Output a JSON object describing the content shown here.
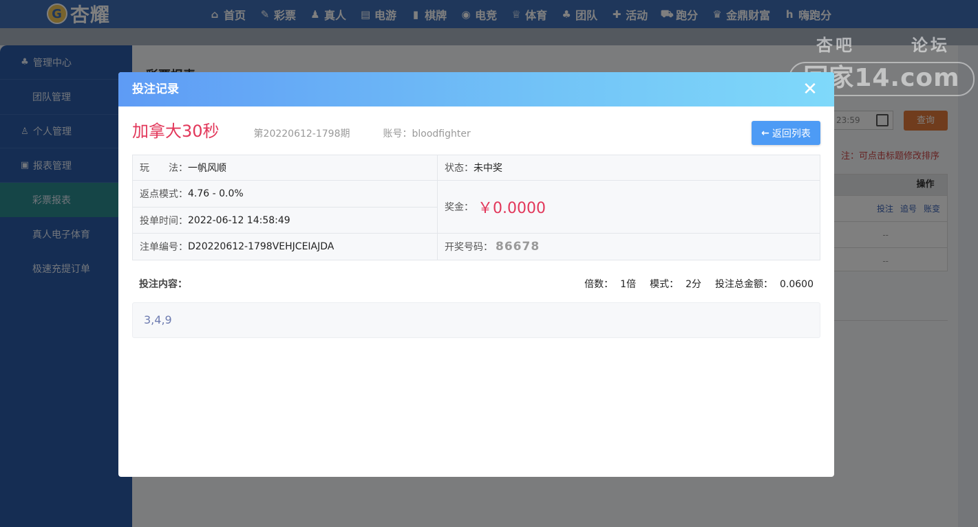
{
  "header": {
    "logo_text": "杏耀",
    "logo_badge": "G",
    "nav": [
      {
        "label": "首页",
        "icon": "home-icon",
        "glyph": "⌂"
      },
      {
        "label": "彩票",
        "icon": "ticket-icon",
        "glyph": "✎"
      },
      {
        "label": "真人",
        "icon": "people-icon",
        "glyph": "♟"
      },
      {
        "label": "电游",
        "icon": "game-machine-icon",
        "glyph": "▤"
      },
      {
        "label": "棋牌",
        "icon": "card-icon",
        "glyph": "▮"
      },
      {
        "label": "电竞",
        "icon": "gamepad-icon",
        "glyph": "◉"
      },
      {
        "label": "体育",
        "icon": "trophy-icon",
        "glyph": "♕"
      },
      {
        "label": "团队",
        "icon": "team-icon",
        "glyph": "♣"
      },
      {
        "label": "活动",
        "icon": "gift-icon",
        "glyph": "✚"
      },
      {
        "label": "跑分",
        "icon": "truck-icon",
        "glyph": "⛟"
      },
      {
        "label": "金鼎财富",
        "icon": "wealth-icon",
        "glyph": "♛"
      },
      {
        "label": "嗨跑分",
        "icon": "hi-icon",
        "glyph": "h"
      }
    ]
  },
  "sidebar": {
    "groups": [
      {
        "label": "管理中心",
        "icon": "users-icon",
        "glyph": "♣",
        "items": [
          "团队管理"
        ]
      },
      {
        "label": "个人管理",
        "icon": "user-icon",
        "glyph": "♙",
        "items": []
      },
      {
        "label": "报表管理",
        "icon": "report-icon",
        "glyph": "▣",
        "items": [
          "彩票报表",
          "真人电子体育",
          "极速充提订单"
        ]
      }
    ],
    "active_item": "彩票报表"
  },
  "background": {
    "page_title": "彩票报表",
    "date_value": "23:59",
    "query_label": "查询",
    "note": "注：可点击标题修改排序",
    "table_header": "操作",
    "row_actions": [
      "投注",
      "追号",
      "账变"
    ],
    "dash": "--"
  },
  "watermark": {
    "top_left": "杏吧",
    "top_right": "论坛",
    "main": "回家14.com"
  },
  "modal": {
    "title": "投注记录",
    "close_glyph": "✕",
    "lottery_name": "加拿大30秒",
    "issue": "第20220612-1798期",
    "account_label": "账号：",
    "account_value": "bloodfighter",
    "back_label": "返回列表",
    "play_label": "玩　　法：",
    "play_value": "一帆风顺",
    "status_label": "状态：",
    "status_value": "未中奖",
    "rebate_label": "返点模式：",
    "rebate_value": "4.76 - 0.0%",
    "prize_label": "奖金：",
    "prize_value": "￥0.0000",
    "time_label": "投单时间：",
    "time_value": "2022-06-12 14:58:49",
    "order_label": "注单编号：",
    "order_value": "D20220612-1798VEHJCEIAJDA",
    "draw_label": "开奖号码：",
    "draw_value": "86678",
    "bet_content_label": "投注内容：",
    "multiple_label": "倍数：",
    "multiple_value": "1倍",
    "mode_label": "模式：",
    "mode_value": "2分",
    "total_label": "投注总金额：",
    "total_value": "0.0600",
    "bet_content": "3,4,9"
  },
  "colors": {
    "accent": "#4d9bf5",
    "prize": "#e2375a",
    "sidebar": "#2b5aa6",
    "topbar": "#3e6fb7"
  }
}
